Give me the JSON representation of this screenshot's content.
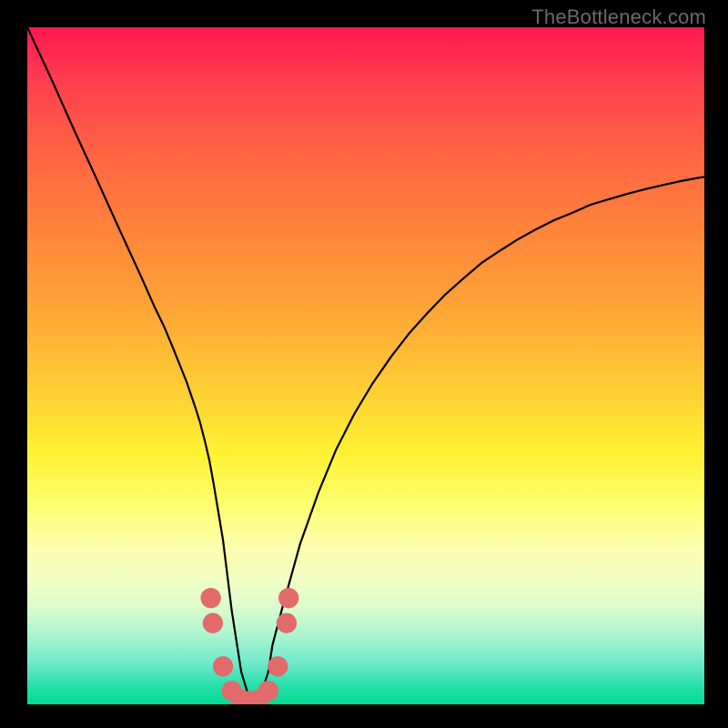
{
  "watermark": "TheBottleneck.com",
  "chart_data": {
    "type": "line",
    "title": "",
    "xlabel": "",
    "ylabel": "",
    "xlim": [
      0,
      100
    ],
    "ylim": [
      0,
      100
    ],
    "background_gradient": {
      "top": "#ff1752",
      "middle": "#fff233",
      "bottom": "#00dc92"
    },
    "series": [
      {
        "name": "curve",
        "x": [
          0,
          3.4,
          6.7,
          10.1,
          13.4,
          16.8,
          18.8,
          20.2,
          21.5,
          23.5,
          24.8,
          25.5,
          26.2,
          26.9,
          27.5,
          28.9,
          30.2,
          31.6,
          32.9,
          34.2,
          35.6,
          36.2,
          37.6,
          40.3,
          43.0,
          45.6,
          48.3,
          51.0,
          53.7,
          56.4,
          59.1,
          61.7,
          64.4,
          67.1,
          69.8,
          72.5,
          75.2,
          77.8,
          80.5,
          83.2,
          85.9,
          88.6,
          91.3,
          93.9,
          96.6,
          99.3,
          100
        ],
        "values": [
          100,
          92.7,
          85.3,
          77.9,
          70.6,
          63.2,
          58.7,
          55.8,
          52.7,
          47.7,
          43.9,
          41.7,
          39.0,
          36.0,
          32.7,
          24.3,
          13.8,
          4.8,
          0.5,
          0.5,
          4.8,
          8.7,
          14.0,
          23.7,
          31.3,
          37.6,
          42.9,
          47.4,
          51.3,
          54.8,
          57.8,
          60.5,
          62.9,
          65.2,
          67.0,
          68.7,
          70.2,
          71.5,
          72.6,
          73.8,
          74.6,
          75.4,
          76.1,
          76.7,
          77.3,
          77.8,
          77.9
        ]
      }
    ],
    "markers": [
      {
        "x": 27.1,
        "y": 15.7
      },
      {
        "x": 27.4,
        "y": 12.0
      },
      {
        "x": 28.9,
        "y": 5.6
      },
      {
        "x": 30.2,
        "y": 2.0
      },
      {
        "x": 31.6,
        "y": 0.7
      },
      {
        "x": 32.9,
        "y": 0.5
      },
      {
        "x": 34.2,
        "y": 0.7
      },
      {
        "x": 35.6,
        "y": 2.0
      },
      {
        "x": 37.0,
        "y": 5.6
      },
      {
        "x": 38.3,
        "y": 12.0
      },
      {
        "x": 38.6,
        "y": 15.7
      }
    ],
    "marker_radius": 1.5
  }
}
